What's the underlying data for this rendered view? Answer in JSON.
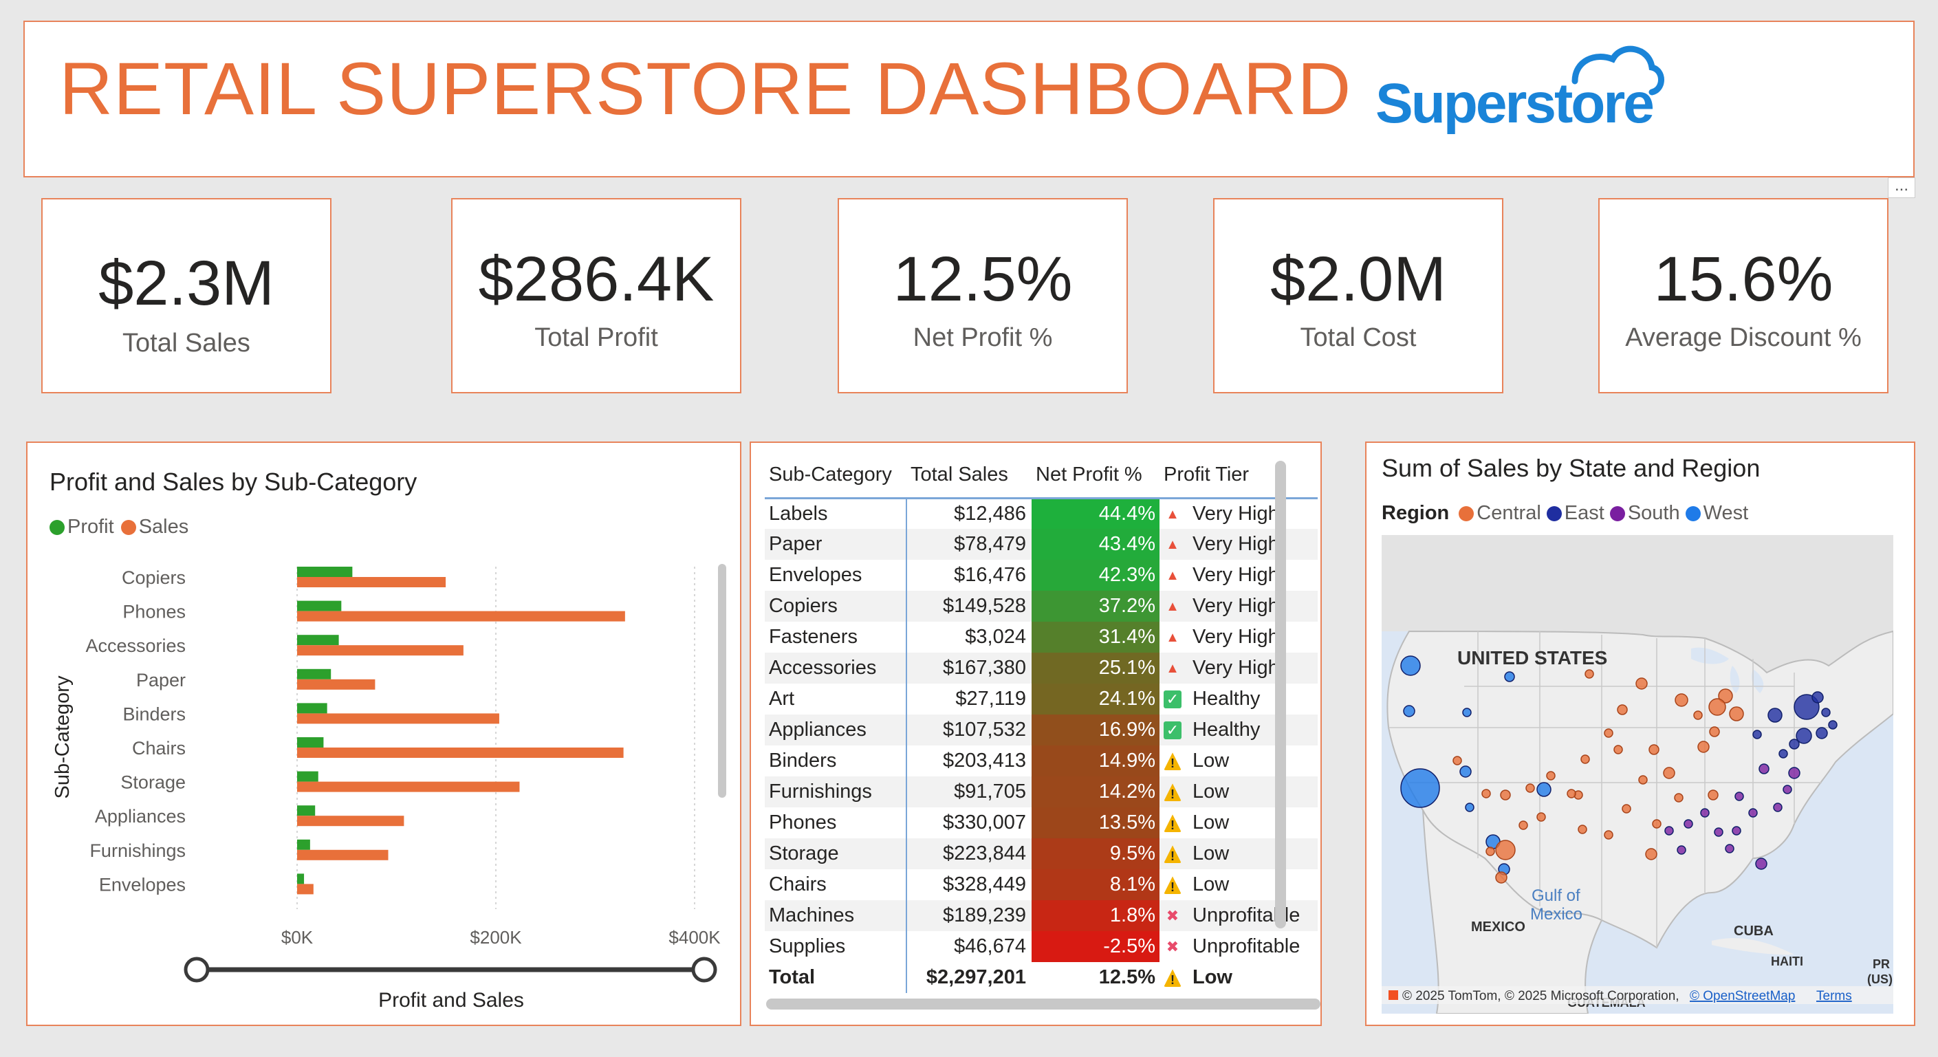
{
  "header": {
    "title": "RETAIL SUPERSTORE DASHBOARD",
    "logo_text": "Superstore",
    "more_label": "..."
  },
  "kpis": [
    {
      "value": "$2.3M",
      "label": "Total Sales"
    },
    {
      "value": "$286.4K",
      "label": "Total Profit"
    },
    {
      "value": "12.5%",
      "label": "Net Profit %"
    },
    {
      "value": "$2.0M",
      "label": "Total Cost"
    },
    {
      "value": "15.6%",
      "label": "Average Discount %"
    }
  ],
  "colors": {
    "accent": "#e8703a",
    "border": "#e8835a",
    "profit": "#2ca02c",
    "sales": "#e8703a",
    "central": "#e8703a",
    "east": "#1f2ea0",
    "south": "#7a1fa0",
    "west": "#1f7be8"
  },
  "chart_data": {
    "type": "bar",
    "title": "Profit and Sales by Sub-Category",
    "ylabel": "Sub-Category",
    "xlabel": "Profit and Sales",
    "categories": [
      "Copiers",
      "Phones",
      "Accessories",
      "Paper",
      "Binders",
      "Chairs",
      "Storage",
      "Appliances",
      "Furnishings",
      "Envelopes"
    ],
    "series": [
      {
        "name": "Profit",
        "values": [
          55618,
          44516,
          41937,
          34054,
          30222,
          26590,
          21279,
          18138,
          13059,
          6964
        ]
      },
      {
        "name": "Sales",
        "values": [
          149528,
          330007,
          167380,
          78479,
          203413,
          328449,
          223844,
          107532,
          91705,
          16476
        ]
      }
    ],
    "xlim": [
      0,
      400000
    ],
    "xticks": [
      "$0K",
      "$200K",
      "$400K"
    ],
    "legend": "top-left",
    "grid": true
  },
  "table": {
    "headers": [
      "Sub-Category",
      "Total Sales",
      "Net Profit %",
      "Profit Tier"
    ],
    "rows": [
      {
        "sub": "Labels",
        "sales": "$12,486",
        "pct": "44.4%",
        "pctv": 44.4,
        "tier": "Very High",
        "icon": "fire-icon"
      },
      {
        "sub": "Paper",
        "sales": "$78,479",
        "pct": "43.4%",
        "pctv": 43.4,
        "tier": "Very High",
        "icon": "fire-icon"
      },
      {
        "sub": "Envelopes",
        "sales": "$16,476",
        "pct": "42.3%",
        "pctv": 42.3,
        "tier": "Very High",
        "icon": "fire-icon"
      },
      {
        "sub": "Copiers",
        "sales": "$149,528",
        "pct": "37.2%",
        "pctv": 37.2,
        "tier": "Very High",
        "icon": "fire-icon"
      },
      {
        "sub": "Fasteners",
        "sales": "$3,024",
        "pct": "31.4%",
        "pctv": 31.4,
        "tier": "Very High",
        "icon": "fire-icon"
      },
      {
        "sub": "Accessories",
        "sales": "$167,380",
        "pct": "25.1%",
        "pctv": 25.1,
        "tier": "Very High",
        "icon": "fire-icon"
      },
      {
        "sub": "Art",
        "sales": "$27,119",
        "pct": "24.1%",
        "pctv": 24.1,
        "tier": "Healthy",
        "icon": "check-icon"
      },
      {
        "sub": "Appliances",
        "sales": "$107,532",
        "pct": "16.9%",
        "pctv": 16.9,
        "tier": "Healthy",
        "icon": "check-icon"
      },
      {
        "sub": "Binders",
        "sales": "$203,413",
        "pct": "14.9%",
        "pctv": 14.9,
        "tier": "Low",
        "icon": "warning-icon"
      },
      {
        "sub": "Furnishings",
        "sales": "$91,705",
        "pct": "14.2%",
        "pctv": 14.2,
        "tier": "Low",
        "icon": "warning-icon"
      },
      {
        "sub": "Phones",
        "sales": "$330,007",
        "pct": "13.5%",
        "pctv": 13.5,
        "tier": "Low",
        "icon": "warning-icon"
      },
      {
        "sub": "Storage",
        "sales": "$223,844",
        "pct": "9.5%",
        "pctv": 9.5,
        "tier": "Low",
        "icon": "warning-icon"
      },
      {
        "sub": "Chairs",
        "sales": "$328,449",
        "pct": "8.1%",
        "pctv": 8.1,
        "tier": "Low",
        "icon": "warning-icon"
      },
      {
        "sub": "Machines",
        "sales": "$189,239",
        "pct": "1.8%",
        "pctv": 1.8,
        "tier": "Unprofitable",
        "icon": "cross-icon"
      },
      {
        "sub": "Supplies",
        "sales": "$46,674",
        "pct": "-2.5%",
        "pctv": -2.5,
        "tier": "Unprofitable",
        "icon": "cross-icon"
      }
    ],
    "total": {
      "sub": "Total",
      "sales": "$2,297,201",
      "pct": "12.5%",
      "tier": "Low",
      "icon": "warning-icon"
    }
  },
  "map": {
    "title": "Sum of Sales by State and Region",
    "legend_label": "Region",
    "regions": [
      "Central",
      "East",
      "South",
      "West"
    ],
    "labels": {
      "country": "UNITED STATES",
      "gulf": "Gulf of\nMexico",
      "mexico": "MEXICO",
      "cuba": "CUBA",
      "haiti": "HAITI",
      "guatemala": "GUATEMALA",
      "pr": "PR\n(US)"
    },
    "attribution": "© 2025 TomTom, © 2025 Microsoft Corporation,",
    "osm_link": "© OpenStreetMap",
    "terms_link": "Terms"
  }
}
